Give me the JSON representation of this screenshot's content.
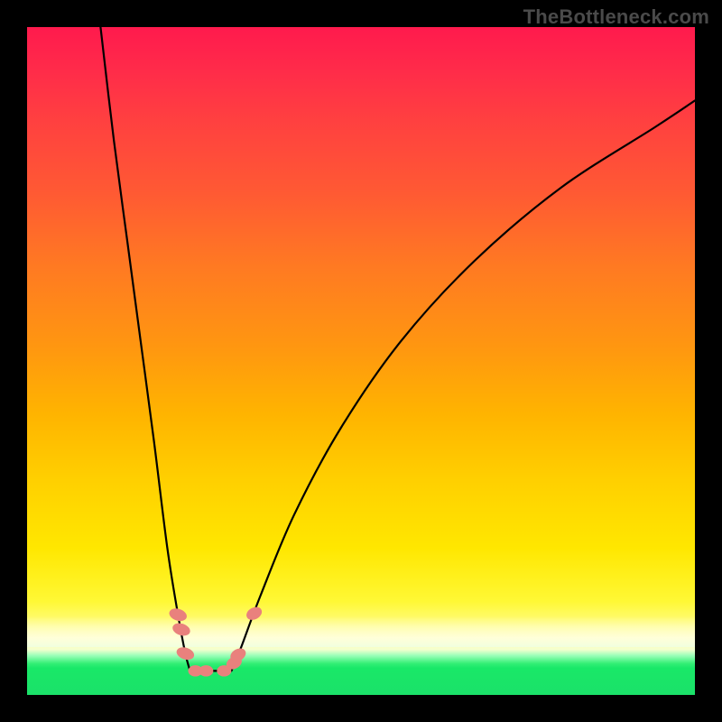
{
  "watermark": "TheBottleneck.com",
  "domain": "Chart",
  "chart_data": {
    "type": "line",
    "title": "",
    "xlabel": "",
    "ylabel": "",
    "xlim": [
      0,
      100
    ],
    "ylim": [
      0,
      100
    ],
    "legend": false,
    "grid": false,
    "background_gradient": {
      "top": "#ff1a4d",
      "mid": "#ffd000",
      "bottom_band": "#ffffd0",
      "bottom_green": "#1be169"
    },
    "description": "Two steep black curves descending from the top of the frame into a narrow V-shaped minimum near x≈27, with a short flat segment at the bottom, then the right branch rising toward the top-right corner. Pink/salmon dot markers cluster near the trough on both branches.",
    "series": [
      {
        "name": "left-branch",
        "x": [
          11,
          13,
          15,
          17,
          19,
          21,
          22.6,
          23.7,
          24.4
        ],
        "y": [
          100,
          83,
          68,
          53,
          38,
          22,
          12,
          6.2,
          3.6
        ]
      },
      {
        "name": "trough-flat",
        "x": [
          24.4,
          30.6
        ],
        "y": [
          3.6,
          3.6
        ]
      },
      {
        "name": "right-branch",
        "x": [
          30.6,
          32,
          35,
          40,
          47,
          56,
          67,
          80,
          94,
          100
        ],
        "y": [
          3.6,
          7,
          15,
          27,
          40,
          53,
          65,
          76,
          85,
          89
        ]
      }
    ],
    "markers": [
      {
        "series": "left-branch",
        "x": 22.6,
        "y": 12.0
      },
      {
        "series": "left-branch",
        "x": 23.1,
        "y": 9.8
      },
      {
        "series": "left-branch",
        "x": 23.7,
        "y": 6.2
      },
      {
        "series": "trough-flat",
        "x": 25.2,
        "y": 3.6
      },
      {
        "series": "trough-flat",
        "x": 26.8,
        "y": 3.6
      },
      {
        "series": "trough-flat",
        "x": 29.5,
        "y": 3.6
      },
      {
        "series": "right-branch",
        "x": 31.0,
        "y": 4.8
      },
      {
        "series": "right-branch",
        "x": 31.6,
        "y": 6.0
      },
      {
        "series": "right-branch",
        "x": 34.0,
        "y": 12.2
      }
    ]
  }
}
